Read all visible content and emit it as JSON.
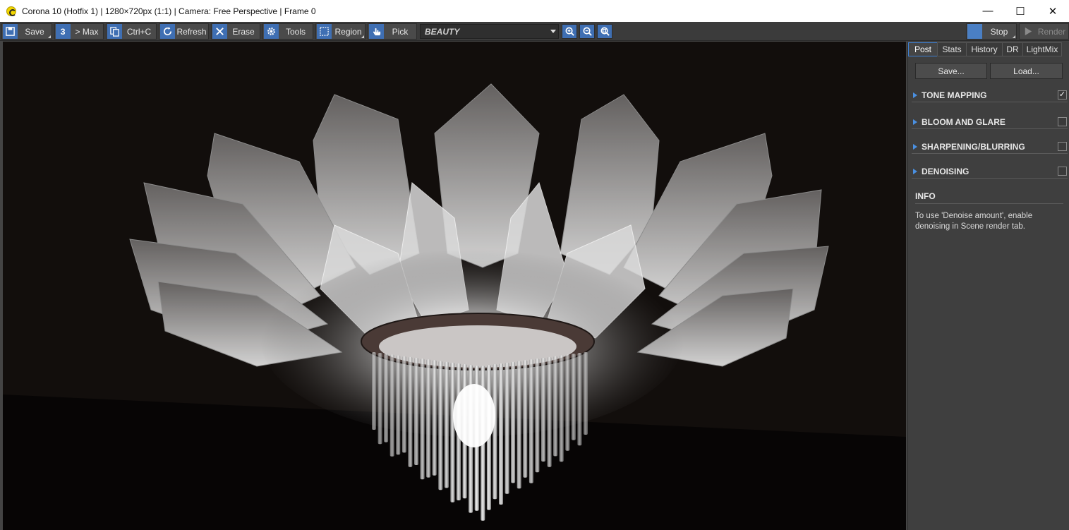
{
  "window": {
    "title": "Corona 10 (Hotfix 1) | 1280×720px (1:1) | Camera: Free Perspective | Frame 0",
    "icon": "corona-logo-icon",
    "minimize": "—",
    "maximize": "☐",
    "close": "✕"
  },
  "toolbar": {
    "save": "Save",
    "to_max": "> Max",
    "copy": "Ctrl+C",
    "refresh": "Refresh",
    "erase": "Erase",
    "tools": "Tools",
    "region": "Region",
    "pick": "Pick",
    "channel": "BEAUTY",
    "stop": "Stop",
    "render": "Render"
  },
  "panel": {
    "tabs": [
      {
        "label": "Post",
        "active": true
      },
      {
        "label": "Stats",
        "active": false
      },
      {
        "label": "History",
        "active": false
      },
      {
        "label": "DR",
        "active": false
      },
      {
        "label": "LightMix",
        "active": false
      }
    ],
    "save_btn": "Save...",
    "load_btn": "Load...",
    "sections": [
      {
        "name": "TONE MAPPING",
        "checked": true
      },
      {
        "name": "BLOOM AND GLARE",
        "checked": false
      },
      {
        "name": "SHARPENING/BLURRING",
        "checked": false
      },
      {
        "name": "DENOISING",
        "checked": false
      }
    ],
    "info_title": "INFO",
    "info_text": "To use 'Denoise amount', enable denoising in Scene render tab."
  },
  "colors": {
    "accent": "#3f6fb3",
    "panel_bg": "#3f3f3f",
    "toolbar_bg": "#3b3b3b",
    "render_bg": "#110d0b"
  }
}
